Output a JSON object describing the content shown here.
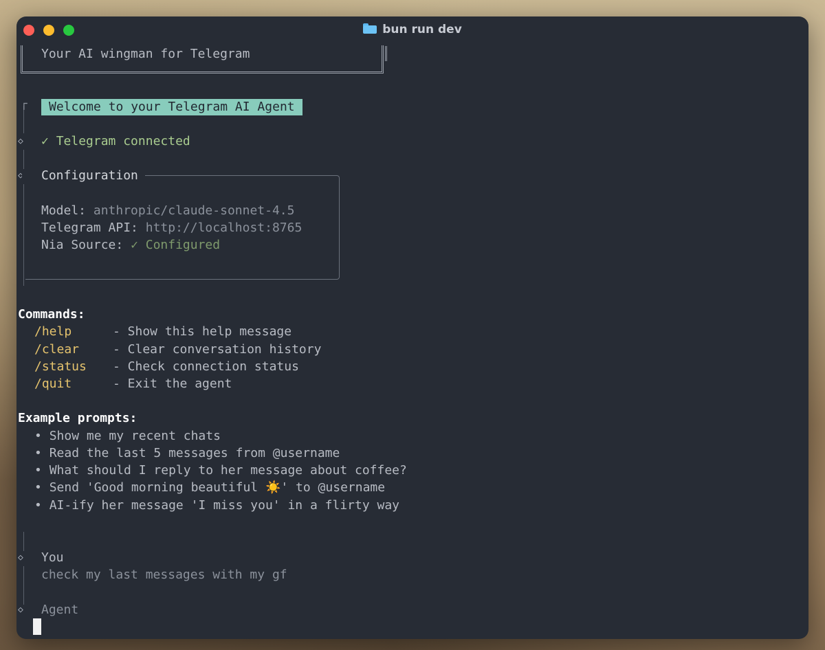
{
  "window": {
    "title": "bun run dev"
  },
  "terminal": {
    "tagline": "Your AI wingman for Telegram",
    "welcome": "Welcome to your Telegram AI Agent",
    "connected_check": "✓",
    "connected_text": "Telegram connected",
    "config": {
      "title": "Configuration",
      "rows": [
        {
          "label": "Model:",
          "value": "anthropic/claude-sonnet-4.5"
        },
        {
          "label": "Telegram API:",
          "value": "http://localhost:8765"
        },
        {
          "label": "Nia Source:",
          "value": "✓ Configured"
        }
      ]
    },
    "commands": {
      "heading": "Commands:",
      "items": [
        {
          "cmd": "/help",
          "desc": "- Show this help message"
        },
        {
          "cmd": "/clear",
          "desc": "- Clear conversation history"
        },
        {
          "cmd": "/status",
          "desc": "- Check connection status"
        },
        {
          "cmd": "/quit",
          "desc": "- Exit the agent"
        }
      ]
    },
    "examples": {
      "heading": "Example prompts:",
      "bullet": "•",
      "items": [
        "Show me my recent chats",
        "Read the last 5 messages from @username",
        "What should I reply to her message about coffee?",
        "Send 'Good morning beautiful ☀️' to @username",
        "AI-ify her message 'I miss you' in a flirty way"
      ]
    },
    "chat": {
      "you_label": "You",
      "you_message": "check my last messages with my gf",
      "agent_label": "Agent"
    }
  },
  "colors": {
    "terminal_bg": "#272c35",
    "welcome_bg": "#88ccbc",
    "command_color": "#e5c36d",
    "success_green": "#a9cc8f"
  }
}
